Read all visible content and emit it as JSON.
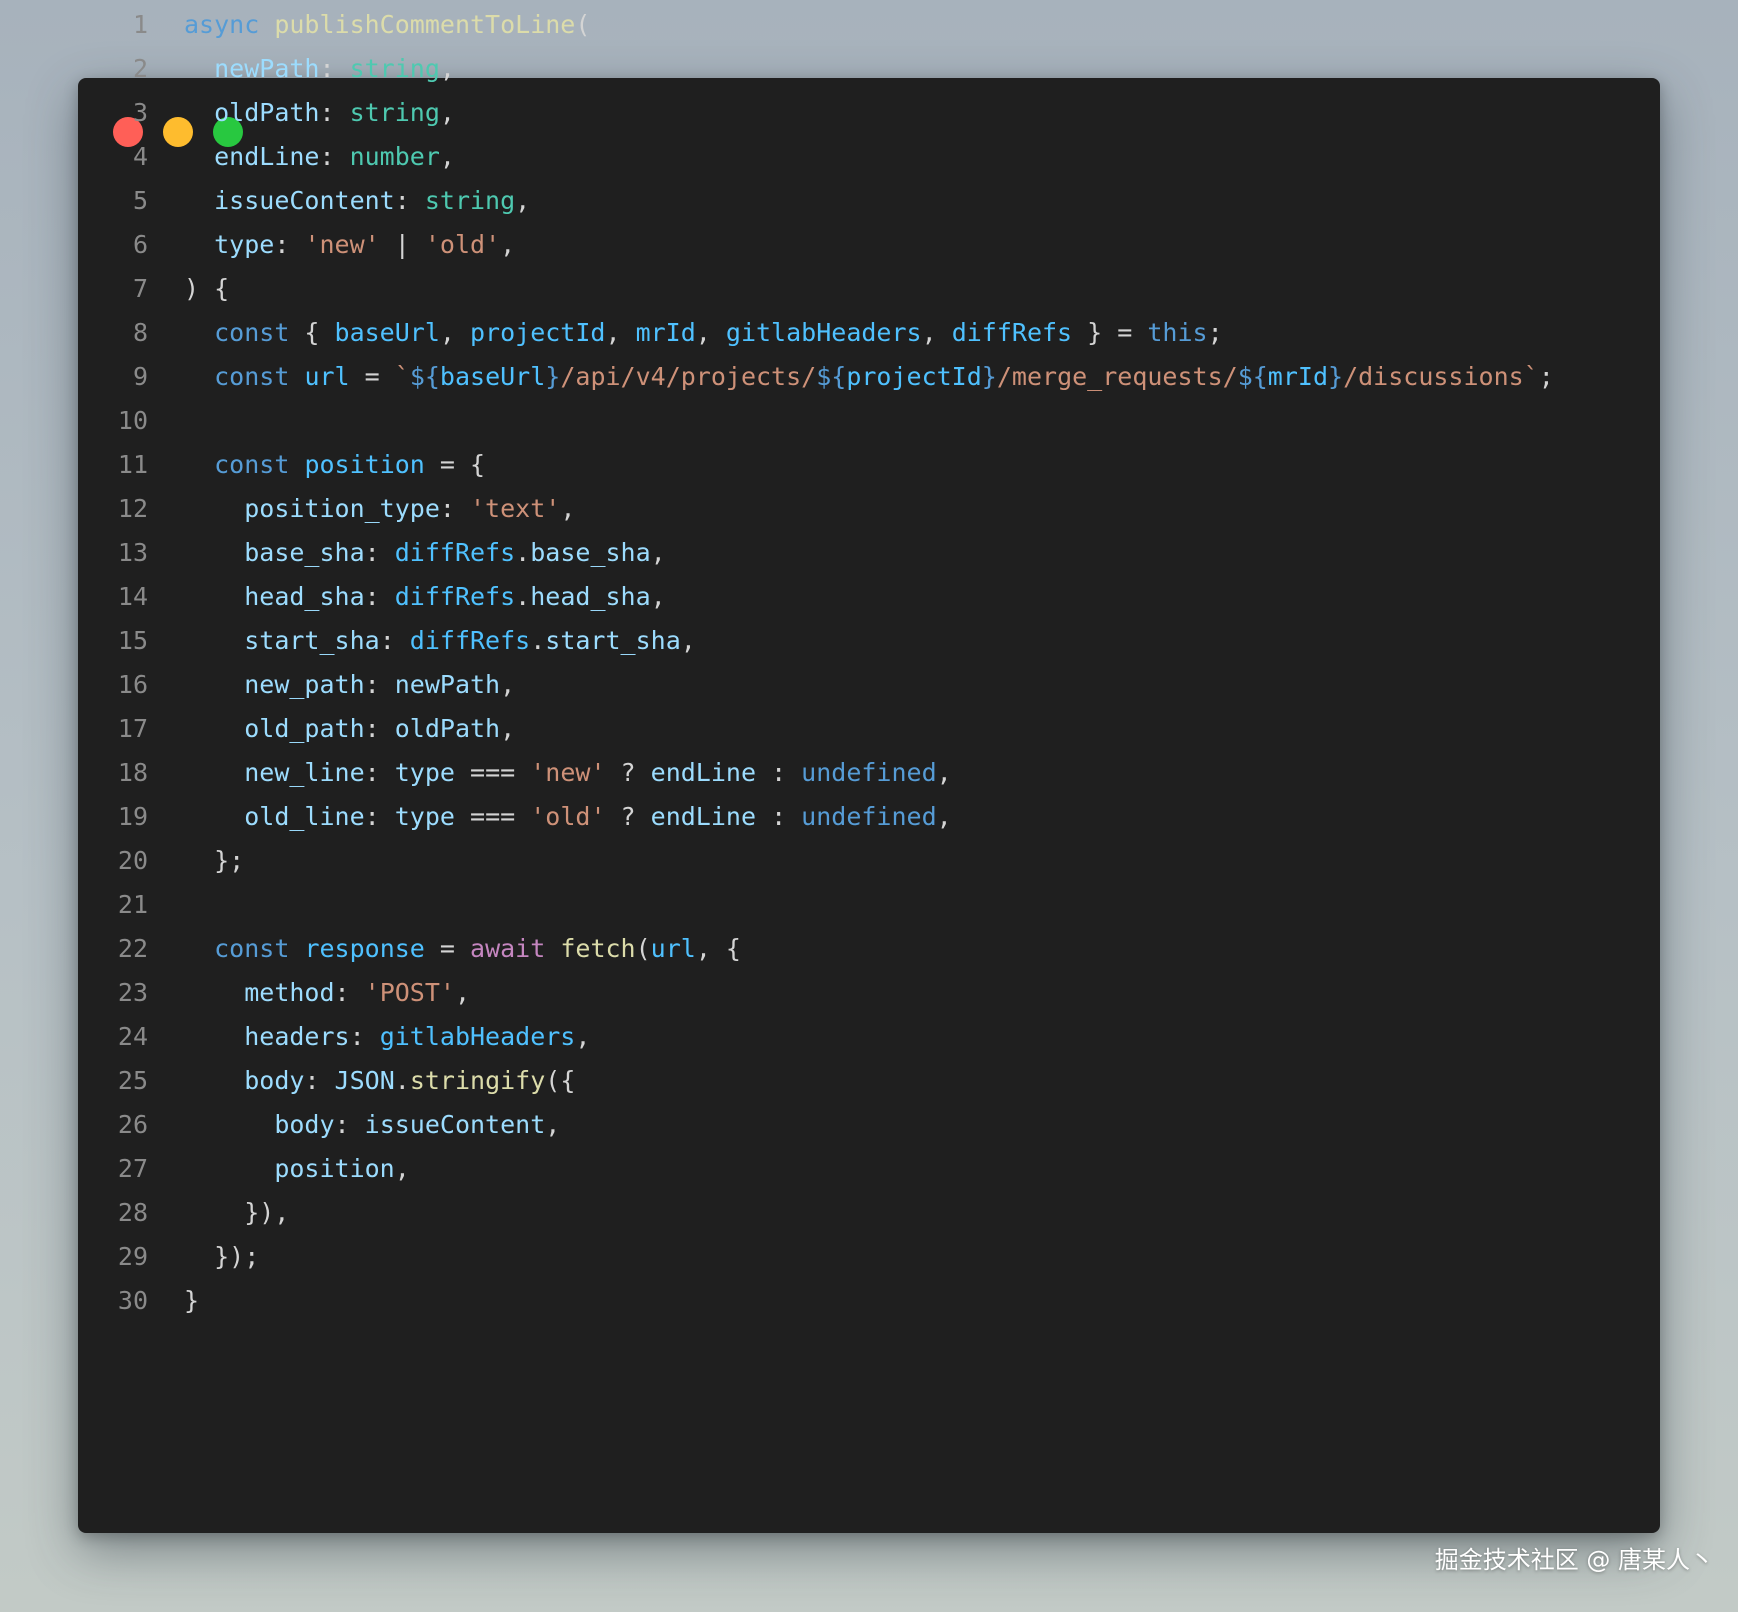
{
  "window": {
    "controls": [
      {
        "name": "close",
        "color": "#ff5f57"
      },
      {
        "name": "minimize",
        "color": "#febc2e"
      },
      {
        "name": "maximize",
        "color": "#28c840"
      }
    ]
  },
  "code": {
    "lines": [
      {
        "n": "1",
        "tokens": [
          [
            "kw",
            "async"
          ],
          [
            "p",
            " "
          ],
          [
            "fn",
            "publishCommentToLine"
          ],
          [
            "p",
            "("
          ]
        ]
      },
      {
        "n": "2",
        "tokens": [
          [
            "p",
            "  "
          ],
          [
            "prop",
            "newPath"
          ],
          [
            "p",
            ": "
          ],
          [
            "type",
            "string"
          ],
          [
            "p",
            ","
          ]
        ]
      },
      {
        "n": "3",
        "tokens": [
          [
            "p",
            "  "
          ],
          [
            "prop",
            "oldPath"
          ],
          [
            "p",
            ": "
          ],
          [
            "type",
            "string"
          ],
          [
            "p",
            ","
          ]
        ]
      },
      {
        "n": "4",
        "tokens": [
          [
            "p",
            "  "
          ],
          [
            "prop",
            "endLine"
          ],
          [
            "p",
            ": "
          ],
          [
            "type",
            "number"
          ],
          [
            "p",
            ","
          ]
        ]
      },
      {
        "n": "5",
        "tokens": [
          [
            "p",
            "  "
          ],
          [
            "prop",
            "issueContent"
          ],
          [
            "p",
            ": "
          ],
          [
            "type",
            "string"
          ],
          [
            "p",
            ","
          ]
        ]
      },
      {
        "n": "6",
        "tokens": [
          [
            "p",
            "  "
          ],
          [
            "prop",
            "type"
          ],
          [
            "p",
            ": "
          ],
          [
            "str",
            "'new'"
          ],
          [
            "p",
            " | "
          ],
          [
            "str",
            "'old'"
          ],
          [
            "p",
            ","
          ]
        ]
      },
      {
        "n": "7",
        "tokens": [
          [
            "p",
            ") {"
          ]
        ]
      },
      {
        "n": "8",
        "tokens": [
          [
            "p",
            "  "
          ],
          [
            "kw",
            "const"
          ],
          [
            "p",
            " { "
          ],
          [
            "var",
            "baseUrl"
          ],
          [
            "p",
            ", "
          ],
          [
            "var",
            "projectId"
          ],
          [
            "p",
            ", "
          ],
          [
            "var",
            "mrId"
          ],
          [
            "p",
            ", "
          ],
          [
            "var",
            "gitlabHeaders"
          ],
          [
            "p",
            ", "
          ],
          [
            "var",
            "diffRefs"
          ],
          [
            "p",
            " } = "
          ],
          [
            "kw",
            "this"
          ],
          [
            "p",
            ";"
          ]
        ]
      },
      {
        "n": "9",
        "tokens": [
          [
            "p",
            "  "
          ],
          [
            "kw",
            "const"
          ],
          [
            "p",
            " "
          ],
          [
            "var",
            "url"
          ],
          [
            "p",
            " = "
          ],
          [
            "str",
            "`"
          ],
          [
            "kw",
            "${"
          ],
          [
            "var",
            "baseUrl"
          ],
          [
            "kw",
            "}"
          ],
          [
            "str",
            "/api/v4/projects/"
          ],
          [
            "kw",
            "${"
          ],
          [
            "var",
            "projectId"
          ],
          [
            "kw",
            "}"
          ],
          [
            "str",
            "/merge_requests/"
          ],
          [
            "kw",
            "${"
          ],
          [
            "var",
            "mrId"
          ],
          [
            "kw",
            "}"
          ],
          [
            "str",
            "/discussions`"
          ],
          [
            "p",
            ";"
          ]
        ]
      },
      {
        "n": "10",
        "tokens": []
      },
      {
        "n": "11",
        "tokens": [
          [
            "p",
            "  "
          ],
          [
            "kw",
            "const"
          ],
          [
            "p",
            " "
          ],
          [
            "var",
            "position"
          ],
          [
            "p",
            " = {"
          ]
        ]
      },
      {
        "n": "12",
        "tokens": [
          [
            "p",
            "    "
          ],
          [
            "prop",
            "position_type"
          ],
          [
            "p",
            ": "
          ],
          [
            "str",
            "'text'"
          ],
          [
            "p",
            ","
          ]
        ]
      },
      {
        "n": "13",
        "tokens": [
          [
            "p",
            "    "
          ],
          [
            "prop",
            "base_sha"
          ],
          [
            "p",
            ": "
          ],
          [
            "var",
            "diffRefs"
          ],
          [
            "p",
            "."
          ],
          [
            "prop",
            "base_sha"
          ],
          [
            "p",
            ","
          ]
        ]
      },
      {
        "n": "14",
        "tokens": [
          [
            "p",
            "    "
          ],
          [
            "prop",
            "head_sha"
          ],
          [
            "p",
            ": "
          ],
          [
            "var",
            "diffRefs"
          ],
          [
            "p",
            "."
          ],
          [
            "prop",
            "head_sha"
          ],
          [
            "p",
            ","
          ]
        ]
      },
      {
        "n": "15",
        "tokens": [
          [
            "p",
            "    "
          ],
          [
            "prop",
            "start_sha"
          ],
          [
            "p",
            ": "
          ],
          [
            "var",
            "diffRefs"
          ],
          [
            "p",
            "."
          ],
          [
            "prop",
            "start_sha"
          ],
          [
            "p",
            ","
          ]
        ]
      },
      {
        "n": "16",
        "tokens": [
          [
            "p",
            "    "
          ],
          [
            "prop",
            "new_path"
          ],
          [
            "p",
            ": "
          ],
          [
            "prop",
            "newPath"
          ],
          [
            "p",
            ","
          ]
        ]
      },
      {
        "n": "17",
        "tokens": [
          [
            "p",
            "    "
          ],
          [
            "prop",
            "old_path"
          ],
          [
            "p",
            ": "
          ],
          [
            "prop",
            "oldPath"
          ],
          [
            "p",
            ","
          ]
        ]
      },
      {
        "n": "18",
        "tokens": [
          [
            "p",
            "    "
          ],
          [
            "prop",
            "new_line"
          ],
          [
            "p",
            ": "
          ],
          [
            "prop",
            "type"
          ],
          [
            "p",
            " === "
          ],
          [
            "str",
            "'new'"
          ],
          [
            "p",
            " ? "
          ],
          [
            "prop",
            "endLine"
          ],
          [
            "p",
            " : "
          ],
          [
            "kw",
            "undefined"
          ],
          [
            "p",
            ","
          ]
        ]
      },
      {
        "n": "19",
        "tokens": [
          [
            "p",
            "    "
          ],
          [
            "prop",
            "old_line"
          ],
          [
            "p",
            ": "
          ],
          [
            "prop",
            "type"
          ],
          [
            "p",
            " === "
          ],
          [
            "str",
            "'old'"
          ],
          [
            "p",
            " ? "
          ],
          [
            "prop",
            "endLine"
          ],
          [
            "p",
            " : "
          ],
          [
            "kw",
            "undefined"
          ],
          [
            "p",
            ","
          ]
        ]
      },
      {
        "n": "20",
        "tokens": [
          [
            "p",
            "  };"
          ]
        ]
      },
      {
        "n": "21",
        "tokens": []
      },
      {
        "n": "22",
        "tokens": [
          [
            "p",
            "  "
          ],
          [
            "kw",
            "const"
          ],
          [
            "p",
            " "
          ],
          [
            "var",
            "response"
          ],
          [
            "p",
            " = "
          ],
          [
            "ctrl",
            "await"
          ],
          [
            "p",
            " "
          ],
          [
            "fn",
            "fetch"
          ],
          [
            "p",
            "("
          ],
          [
            "var",
            "url"
          ],
          [
            "p",
            ", {"
          ]
        ]
      },
      {
        "n": "23",
        "tokens": [
          [
            "p",
            "    "
          ],
          [
            "prop",
            "method"
          ],
          [
            "p",
            ": "
          ],
          [
            "str",
            "'POST'"
          ],
          [
            "p",
            ","
          ]
        ]
      },
      {
        "n": "24",
        "tokens": [
          [
            "p",
            "    "
          ],
          [
            "prop",
            "headers"
          ],
          [
            "p",
            ": "
          ],
          [
            "var",
            "gitlabHeaders"
          ],
          [
            "p",
            ","
          ]
        ]
      },
      {
        "n": "25",
        "tokens": [
          [
            "p",
            "    "
          ],
          [
            "prop",
            "body"
          ],
          [
            "p",
            ": "
          ],
          [
            "prop",
            "JSON"
          ],
          [
            "p",
            "."
          ],
          [
            "fn",
            "stringify"
          ],
          [
            "p",
            "({"
          ]
        ]
      },
      {
        "n": "26",
        "tokens": [
          [
            "p",
            "      "
          ],
          [
            "prop",
            "body"
          ],
          [
            "p",
            ": "
          ],
          [
            "prop",
            "issueContent"
          ],
          [
            "p",
            ","
          ]
        ]
      },
      {
        "n": "27",
        "tokens": [
          [
            "p",
            "      "
          ],
          [
            "prop",
            "position"
          ],
          [
            "p",
            ","
          ]
        ]
      },
      {
        "n": "28",
        "tokens": [
          [
            "p",
            "    }),"
          ]
        ]
      },
      {
        "n": "29",
        "tokens": [
          [
            "p",
            "  });"
          ]
        ]
      },
      {
        "n": "30",
        "tokens": [
          [
            "p",
            "}"
          ]
        ]
      }
    ]
  },
  "watermark": "掘金技术社区 @ 唐某人丶"
}
